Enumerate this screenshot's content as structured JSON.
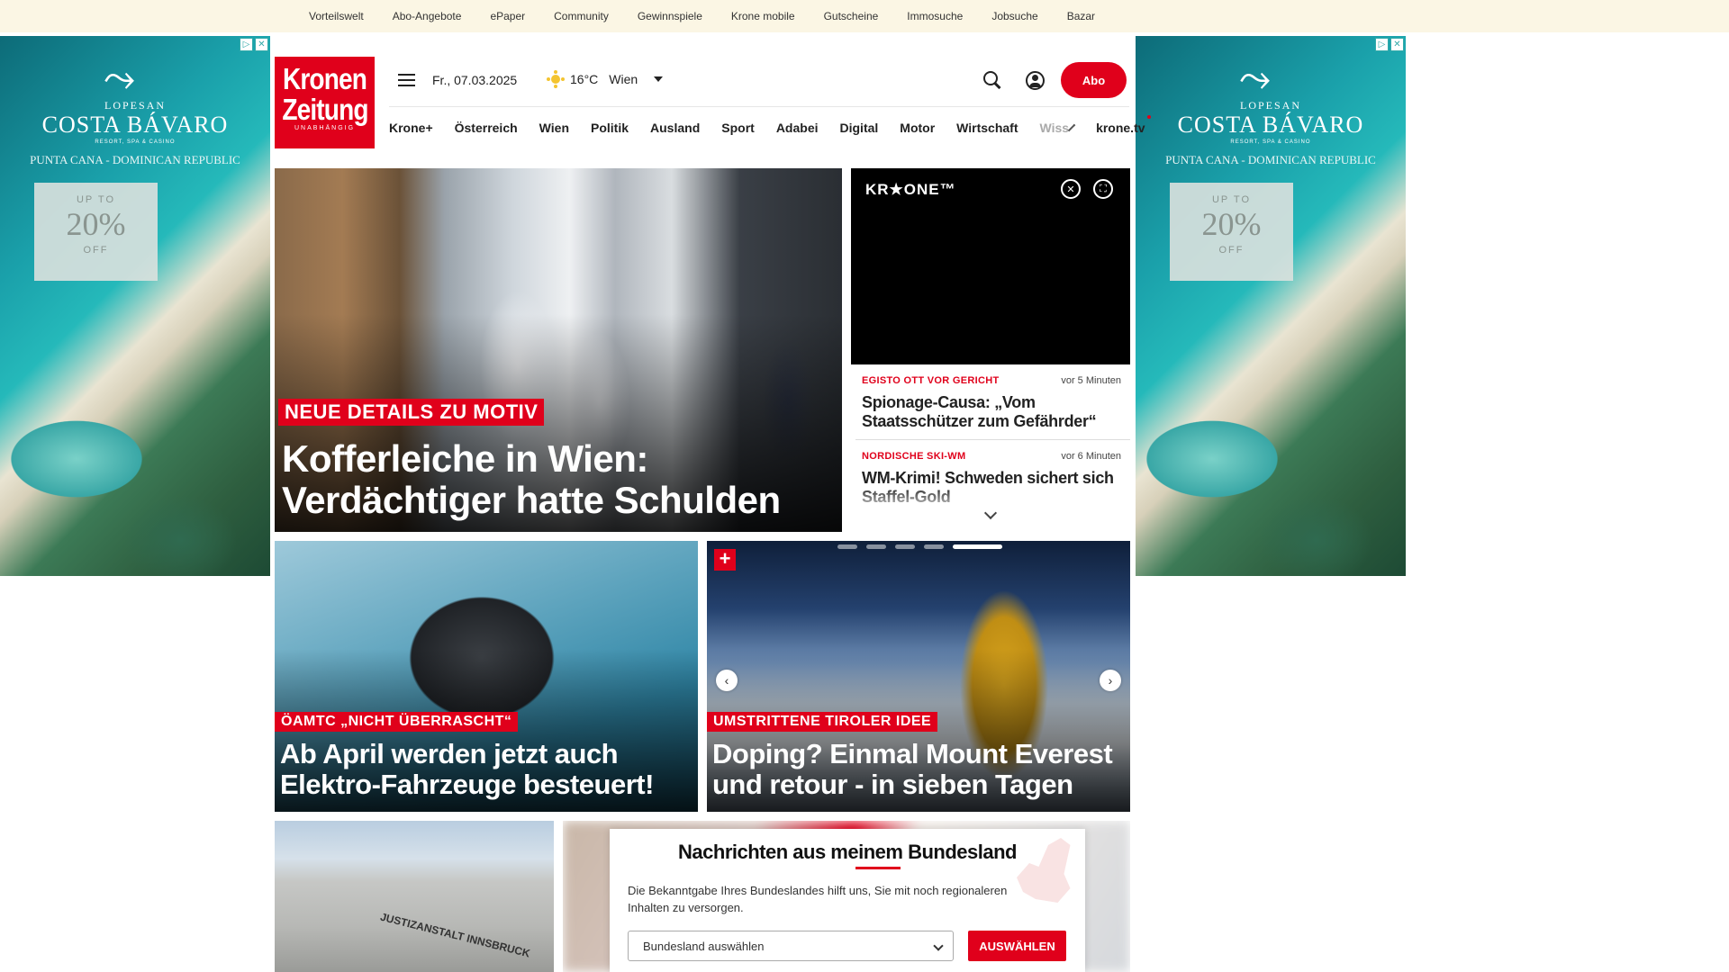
{
  "topnav": [
    "Vorteilswelt",
    "Abo-Angebote",
    "ePaper",
    "Community",
    "Gewinnspiele",
    "Krone mobile",
    "Gutscheine",
    "Immosuche",
    "Jobsuche",
    "Bazar"
  ],
  "ad": {
    "brand_small": "LOPESAN",
    "brand_main": "COSTA BÁVARO",
    "brand_sub": "RESORT, SPA & CASINO",
    "location": "PUNTA CANA - DOMINICAN REPUBLIC",
    "offer_top": "UP TO",
    "offer_percent": "20%",
    "offer_bottom": "OFF"
  },
  "logo": {
    "line1": "Kronen",
    "line2": "Zeitung",
    "tagline": "UNABHÄNGIG"
  },
  "header": {
    "date": "Fr., 07.03.2025",
    "temperature": "16°C",
    "city": "Wien",
    "abo_label": "Abo"
  },
  "nav": {
    "items": [
      "Krone+",
      "Österreich",
      "Wien",
      "Politik",
      "Ausland",
      "Sport",
      "Adabei",
      "Digital",
      "Motor",
      "Wirtschaft"
    ],
    "faded": "Wiss",
    "ktv": "krone.tv"
  },
  "hero": {
    "kicker": "NEUE DETAILS ZU MOTIV",
    "headline_line1": "Kofferleiche in Wien:",
    "headline_line2": "Verdächtiger hatte Schulden"
  },
  "video": {
    "logo": "KR★ONE™"
  },
  "ticker": [
    {
      "kicker": "EGISTO OTT VOR GERICHT",
      "time": "vor 5 Minuten",
      "headline": "Spionage-Causa: „Vom Staatsschützer zum Gefährder“"
    },
    {
      "kicker": "NORDISCHE SKI-WM",
      "time": "vor 6 Minuten",
      "headline": "WM-Krimi! Schweden sichert sich Staffel-Gold"
    }
  ],
  "card_left": {
    "kicker": "ÖAMTC „NICHT ÜBERRASCHT“",
    "headline_line1": "Ab April werden jetzt auch",
    "headline_line2": "Elektro-Fahrzeuge besteuert!"
  },
  "card_right": {
    "kicker": "UMSTRITTENE TIROLER IDEE",
    "headline_line1": "Doping? Einmal Mount Everest",
    "headline_line2": "und retour - in sieben Tagen"
  },
  "carousel": {
    "total": 5,
    "active": 5
  },
  "bottom_image_text": "JUSTIZANSTALT INNSBRUCK",
  "modal": {
    "title": "Nachrichten aus meinem Bundesland",
    "description": "Die Bekanntgabe Ihres Bundeslandes hilft uns, Sie mit noch regionaleren Inhalten zu versorgen.",
    "select_placeholder": "Bundesland auswählen",
    "button_label": "AUSWÄHLEN"
  },
  "colors": {
    "brand_red": "#e0001b",
    "topbar_bg": "#fbf6e4"
  }
}
